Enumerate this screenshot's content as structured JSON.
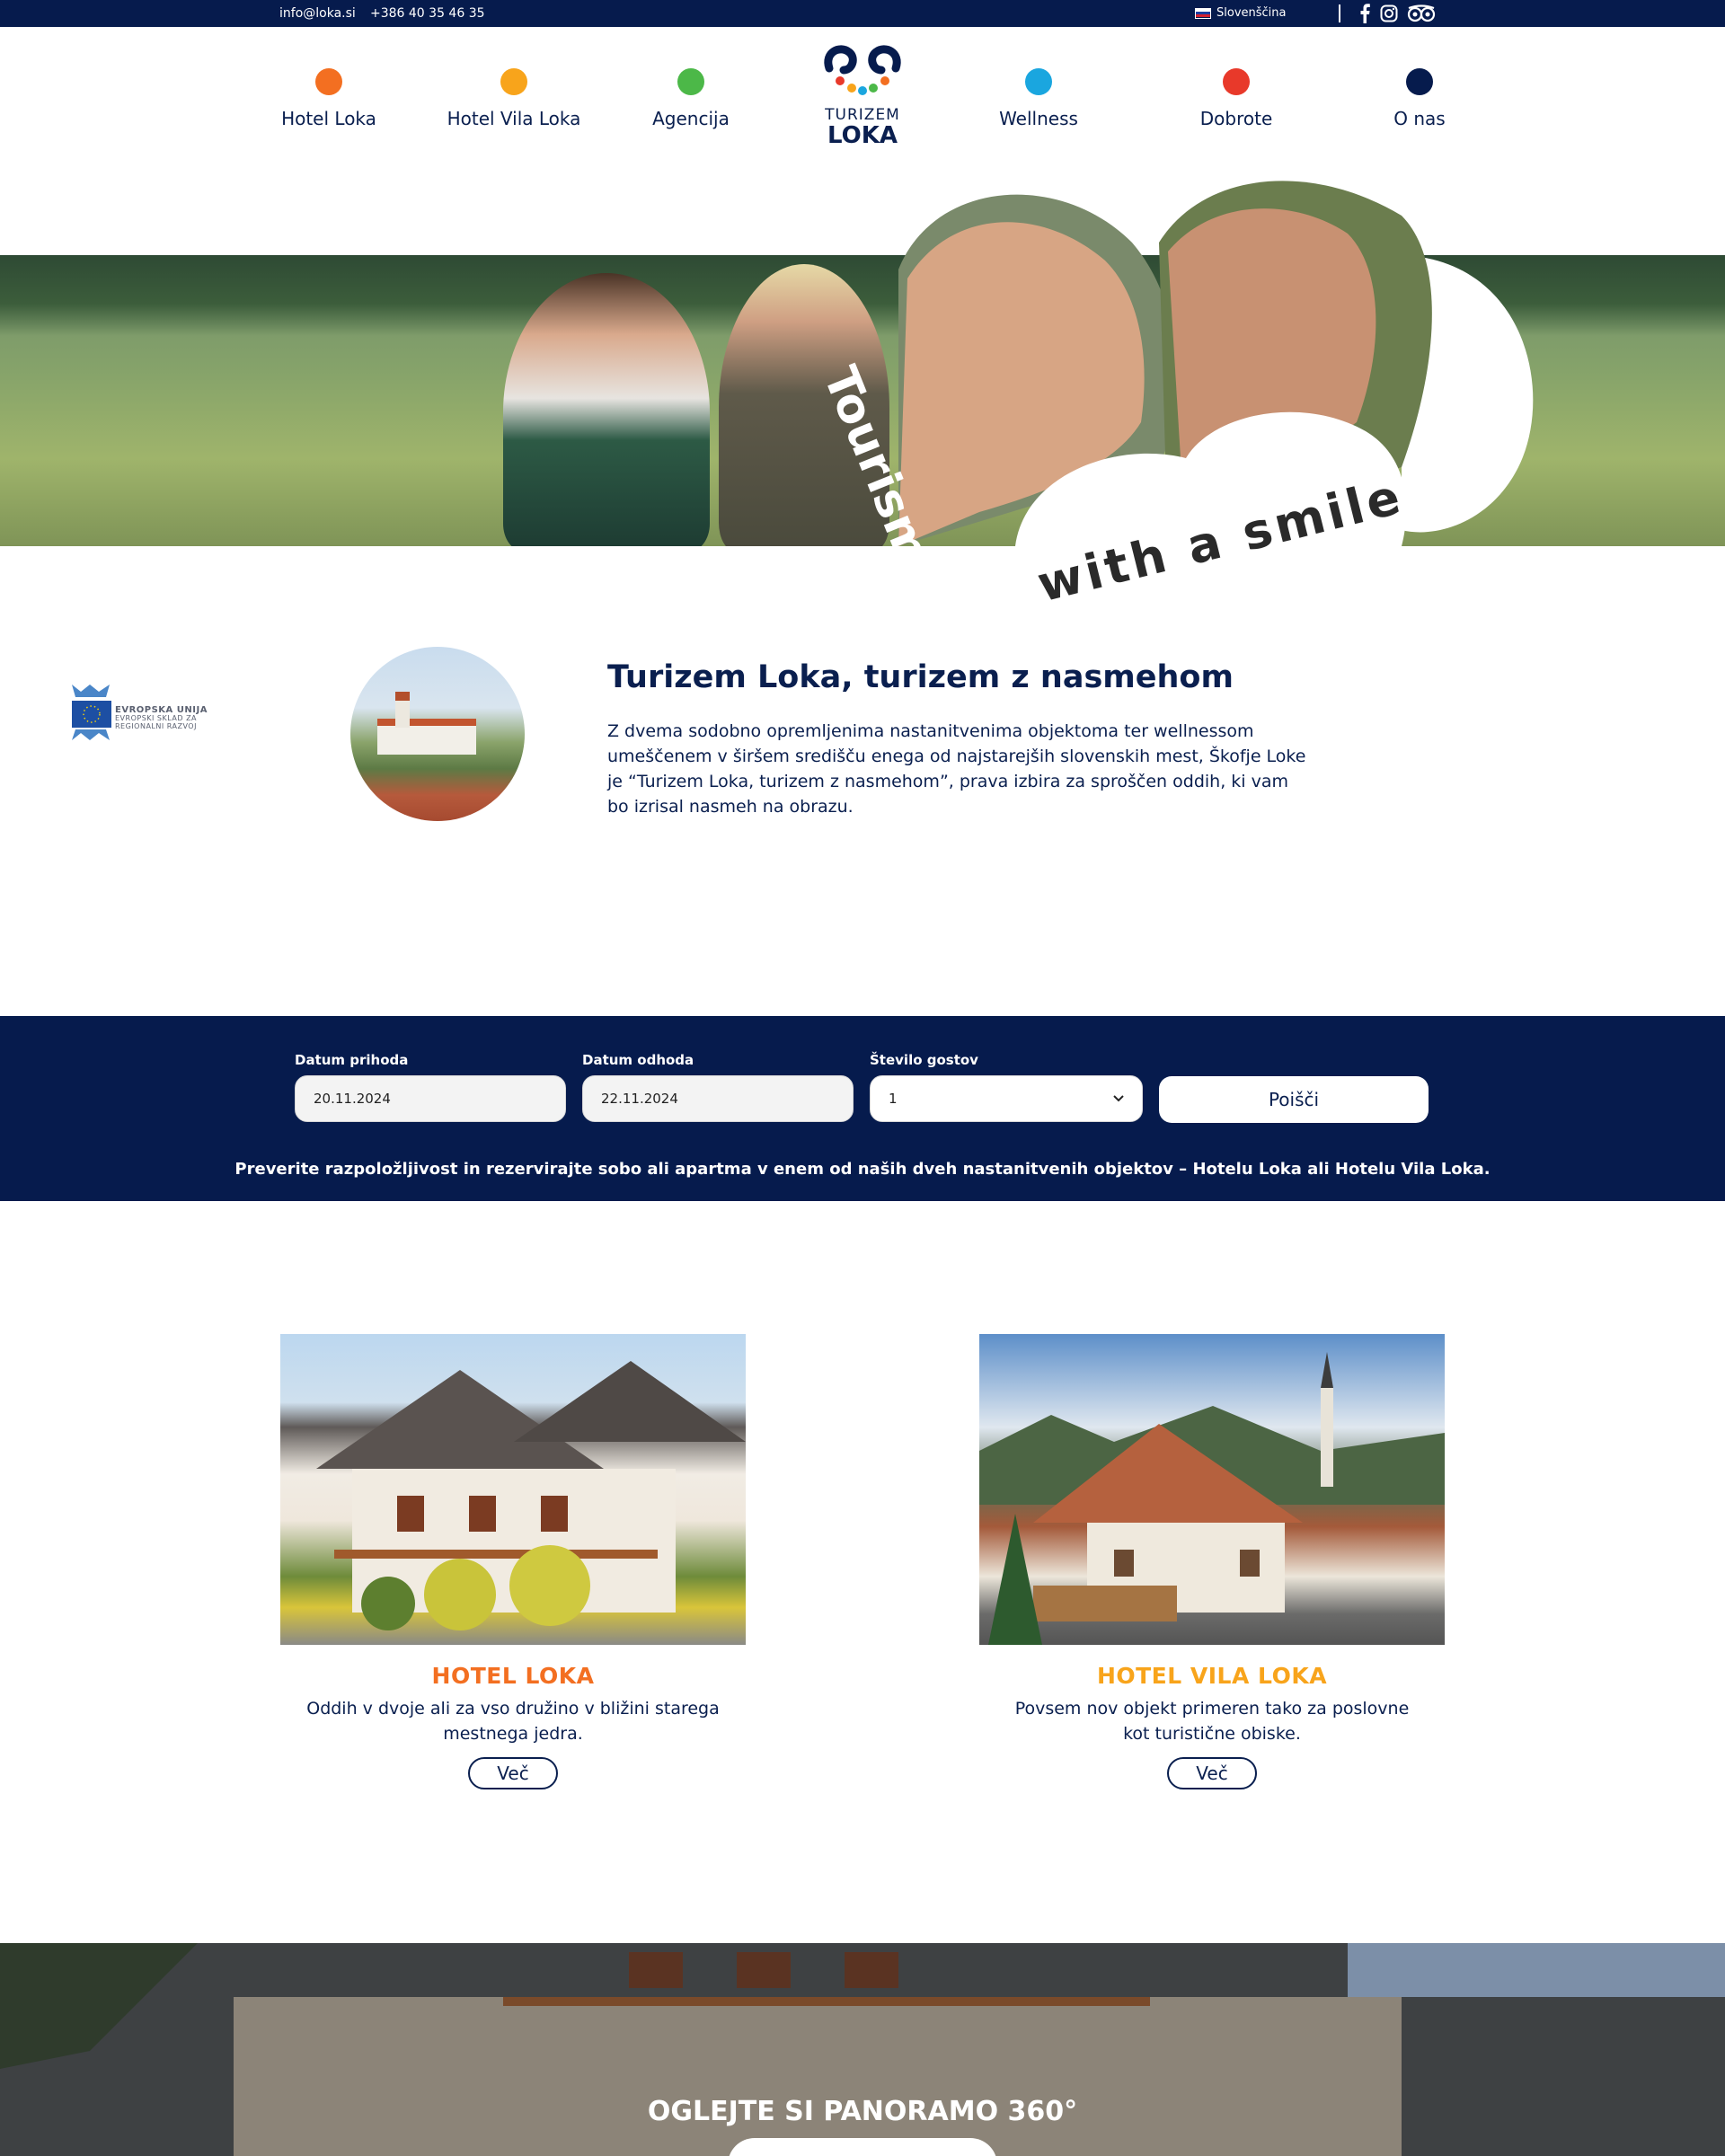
{
  "topbar": {
    "email": "info@loka.si",
    "phone": "+386 40 35 46 35",
    "language": "Slovenščina",
    "social_icons": [
      "facebook-icon",
      "instagram-icon",
      "tripadvisor-icon"
    ]
  },
  "nav": {
    "items": [
      {
        "label": "Hotel Loka",
        "color": "#f36f21"
      },
      {
        "label": "Hotel Vila Loka",
        "color": "#f8a41b"
      },
      {
        "label": "Agencija",
        "color": "#4cb848"
      },
      {
        "label": "Wellness",
        "color": "#1aa6df"
      },
      {
        "label": "Dobrote",
        "color": "#e8392a"
      },
      {
        "label": "O nas",
        "color": "#061b4d"
      }
    ],
    "logo": {
      "line1": "TURIZEM",
      "line2": "LOKA"
    }
  },
  "hero": {
    "slogan_1": "Tourism",
    "slogan_2": "with a smile"
  },
  "intro": {
    "eu_logo": {
      "line1": "EVROPSKA UNIJA",
      "line2": "EVROPSKI SKLAD ZA",
      "line3": "REGIONALNI RAZVOJ"
    },
    "title": "Turizem Loka, turizem z nasmehom",
    "text": "Z dvema sodobno opremljenima nastanitvenima objektoma ter wellnessom umeščenem v širšem središču enega od najstarejših slovenskih mest, Škofje Loke je “Turizem Loka, turizem z nasmehom”, prava izbira za sproščen oddih, ki vam bo izrisal nasmeh na obrazu."
  },
  "booking": {
    "arrival_label": "Datum prihoda",
    "arrival_value": "20.11.2024",
    "departure_label": "Datum odhoda",
    "departure_value": "22.11.2024",
    "guests_label": "Število gostov",
    "guests_value": "1",
    "search_label": "Poišči",
    "note": "Preverite razpoložljivost in rezervirajte sobo ali apartma v enem od naših dveh nastanitvenih objektov – Hotelu Loka ali Hotelu Vila Loka."
  },
  "cards": [
    {
      "title": "HOTEL LOKA",
      "color": "#f36f21",
      "text": "Oddih v dvoje ali za vso družino v bližini starega mestnega jedra.",
      "button": "Več"
    },
    {
      "title": "HOTEL VILA LOKA",
      "color": "#f8a41b",
      "text": "Povsem nov objekt primeren tako za poslovne kot turistične obiske.",
      "button": "Več"
    }
  ],
  "panorama": {
    "title": "OGLEJTE SI PANORAMO 360°"
  }
}
